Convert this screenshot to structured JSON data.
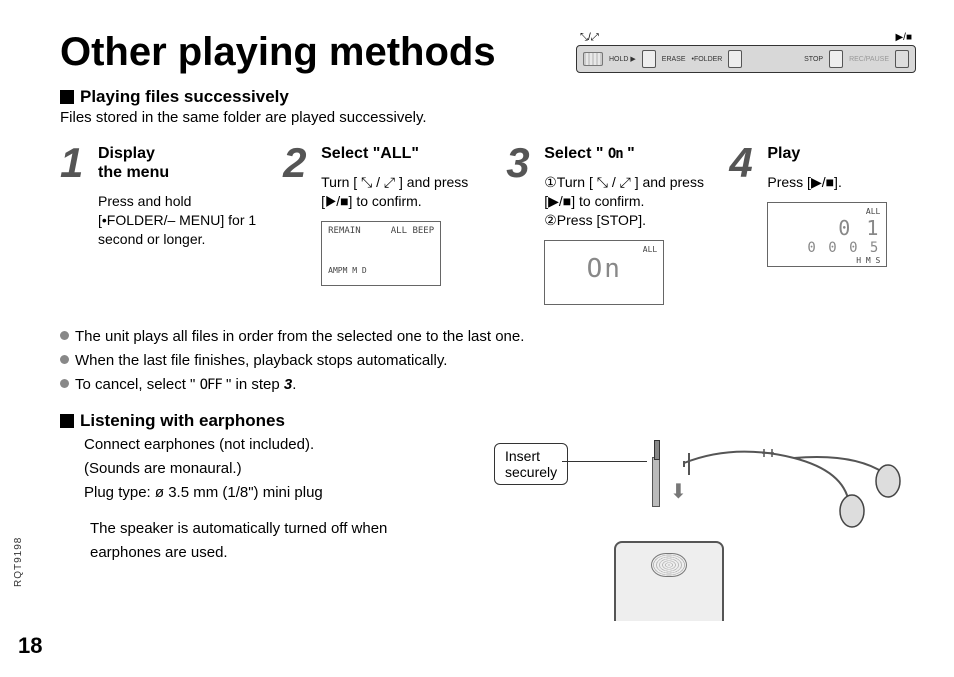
{
  "title": "Other playing methods",
  "section1": {
    "heading": "Playing files successively",
    "intro": "Files stored in the same folder are played successively."
  },
  "steps": [
    {
      "num": "1",
      "title": "Display\nthe menu",
      "instr": "Press and hold [•FOLDER/– MENU] for 1 second or longer."
    },
    {
      "num": "2",
      "title": "Select \"ALL\"",
      "instr": "Turn [ ⤡ / ⤢ ] and press [▶/■] to confirm.",
      "lcd": {
        "line1": "REMAIN",
        "line2": "ALL BEEP",
        "line3": "AMPM   M   D"
      }
    },
    {
      "num": "3",
      "title_prefix": "Select \" ",
      "title_glyph": "On",
      "title_suffix": " \"",
      "instr": "①Turn [ ⤡ / ⤢ ] and press [▶/■] to confirm.\n②Press [STOP].",
      "lcd": {
        "big": "On",
        "corner": "ALL"
      }
    },
    {
      "num": "4",
      "title": "Play",
      "instr": "Press [▶/■].",
      "lcd": {
        "big": "0 1",
        "corner": "ALL",
        "bottom": "0 0 0 5",
        "units": "H   M   S"
      }
    }
  ],
  "bullets": [
    "The unit plays all files in order from the selected one to the last one.",
    "When the last file finishes, playback stops automatically."
  ],
  "bullet_cancel": {
    "pre": "To cancel, select \" ",
    "glyph": "OFF",
    "post": " \" in step ",
    "step": "3",
    "end": "."
  },
  "section2": {
    "heading": "Listening with earphones",
    "body": "Connect earphones (not included).\n(Sounds are monaural.)\nPlug type: ø 3.5 mm (1/8\") mini plug",
    "note": "The speaker is automatically turned off when earphones are used.",
    "callout": "Insert\nsecurely"
  },
  "device_top": {
    "left_label": "⤡/⤢",
    "right_label": "▶/■",
    "buttons": [
      "HOLD ▶",
      "ERASE",
      "•FOLDER",
      "STOP",
      "REC/PAUSE"
    ]
  },
  "doc_code": "RQT9198",
  "page": "18"
}
